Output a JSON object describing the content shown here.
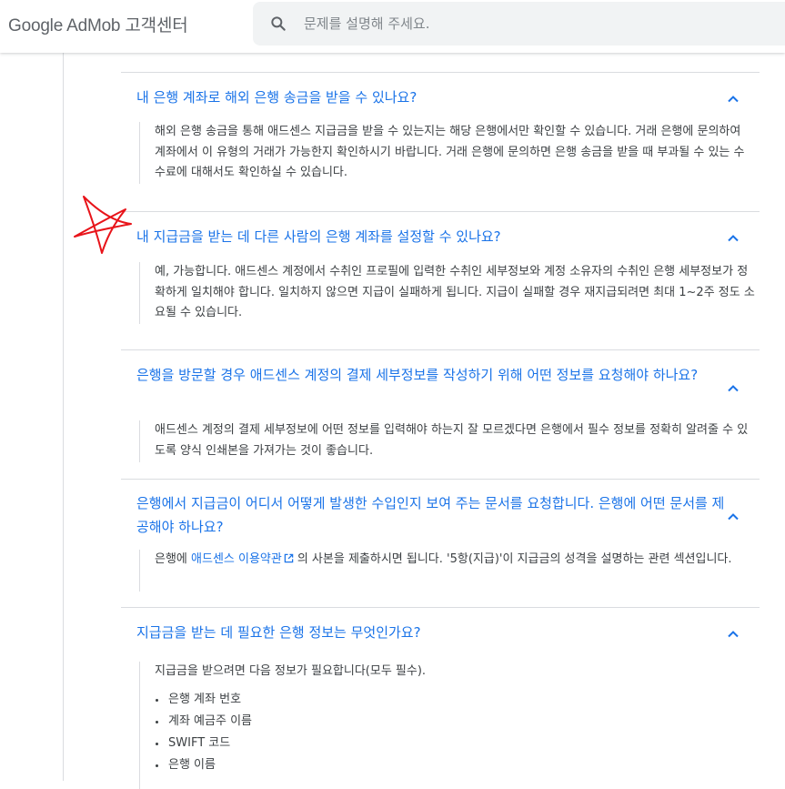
{
  "header": {
    "brand": "Google AdMob 고객센터",
    "search_placeholder": "문제를 설명해 주세요."
  },
  "faq": [
    {
      "question": "내 은행 계좌로 해외 은행 송금을 받을 수 있나요?",
      "answer": "해외 은행 송금을 통해 애드센스 지급금을 받을 수 있는지는 해당 은행에서만 확인할 수 있습니다. 거래 은행에 문의하여 계좌에서 이 유형의 거래가 가능한지 확인하시기 바랍니다. 거래 은행에 문의하면 은행 송금을 받을 때 부과될 수 있는 수수료에 대해서도 확인하실 수 있습니다."
    },
    {
      "question": "내 지급금을 받는 데 다른 사람의 은행 계좌를 설정할 수 있나요?",
      "answer": "예, 가능합니다. 애드센스 계정에서 수취인 프로필에 입력한 수취인 세부정보와 계정 소유자의 수취인 은행 세부정보가 정확하게 일치해야 합니다. 일치하지 않으면 지급이 실패하게 됩니다. 지급이 실패할 경우 재지급되려면 최대 1~2주 정도 소요될 수 있습니다."
    },
    {
      "question": "은행을 방문할 경우 애드센스 계정의 결제 세부정보를 작성하기 위해 어떤 정보를 요청해야 하나요?",
      "answer": "애드센스 계정의 결제 세부정보에 어떤 정보를 입력해야 하는지 잘 모르겠다면 은행에서 필수 정보를 정확히 알려줄 수 있도록 양식 인쇄본을 가져가는 것이 좋습니다."
    },
    {
      "question": "은행에서 지급금이 어디서 어떻게 발생한 수입인지 보여 주는 문서를 요청합니다. 은행에 어떤 문서를 제공해야 하나요?",
      "answer_prefix": "은행에",
      "answer_link": "애드센스 이용약관",
      "answer_suffix": "의 사본을 제출하시면 됩니다. '5항(지급)'이 지급금의 성격을 설명하는 관련 섹션입니다."
    },
    {
      "question": "지급금을 받는 데 필요한 은행 정보는 무엇인가요?",
      "answer": "지급금을 받으려면 다음 정보가 필요합니다(모두 필수).",
      "bullets": [
        "은행 계좌 번호",
        "계좌 예금주 이름",
        "SWIFT 코드",
        "은행 이름"
      ]
    }
  ],
  "colors": {
    "link": "#1a73e8",
    "annotation_star": "#e8141a"
  },
  "icons": {
    "search": "search-icon",
    "chevron": "chevron-up-icon",
    "external_link": "external-link-icon",
    "annotation": "hand-drawn-star-icon"
  }
}
